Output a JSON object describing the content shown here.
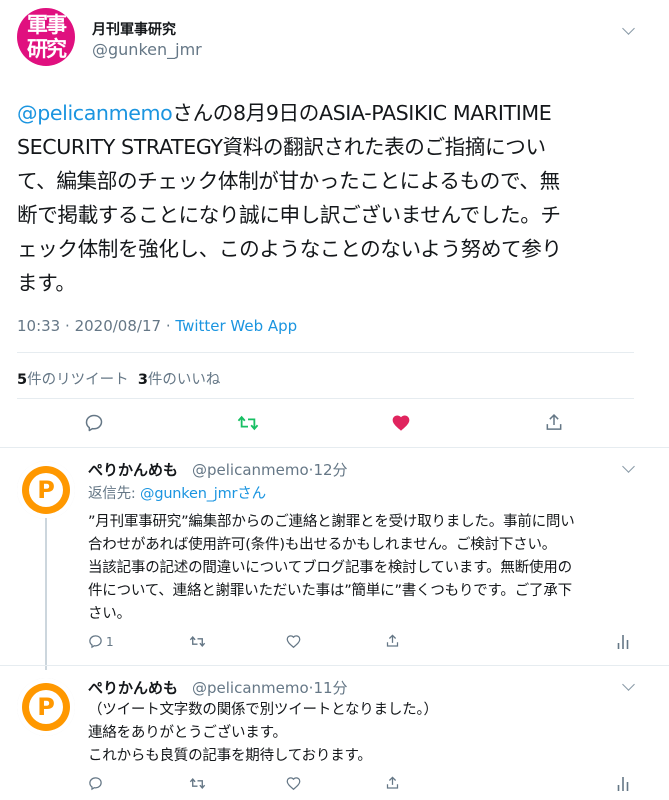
{
  "tweet": {
    "avatar_text": [
      "軍事",
      "研究"
    ],
    "author_name": "月刊軍事研究",
    "author_handle": "@gunken_jmr",
    "mention": "@pelicanmemo",
    "text_lines": [
      "さんの8月9日のASIA-PASIKIC MARITIME",
      "SECURITY STRATEGY資料の翻訳された表のご指摘につい",
      "て、編集部のチェック体制が甘かったことによるもので、無",
      "断で掲載することになり誠に申し訳ございませんでした。チ",
      "ェック体制を強化し、このようなことのないよう努めて参り",
      "ます。"
    ],
    "time": "10:33",
    "date": "2020/08/17",
    "separator": "·",
    "source": "Twitter Web App",
    "retweet_count": "5",
    "retweet_label": "件のリツイート",
    "like_count": "3",
    "like_label": "件のいいね",
    "icons": [
      "reply-icon",
      "retweet-icon",
      "like-icon-filled",
      "share-icon"
    ],
    "colors": {
      "retweet": "#17bf63",
      "like": "#e0245e",
      "link": "#1b95e0",
      "avatar": "#e0107f"
    }
  },
  "replies": [
    {
      "name": "ぺりかんめも",
      "handle": "@pelicanmemo",
      "time_ago": "12分",
      "reply_to_label": "返信先:",
      "reply_to_handle": "@gunken_jmr",
      "reply_to_suffix": "さん",
      "lines": [
        "”月刊軍事研究”編集部からのご連絡と謝罪とを受け取りました。事前に問い",
        "合わせがあれば使用許可(条件)も出せるかもしれません。ご検討下さい。",
        "当該記事の記述の間違いについてブログ記事を検討しています。無断使用の",
        "件について、連絡と謝罪いただいた事は”簡単に”書くつもりです。ご了承下",
        "さい。"
      ],
      "reply_count": "1",
      "avatar_letter": "P"
    },
    {
      "name": "ぺりかんめも",
      "handle": "@pelicanmemo",
      "time_ago": "11分",
      "lines": [
        "（ツイート文字数の関係で別ツイートとなりました。）",
        "連絡をありがとうございます。",
        "これからも良質の記事を期待しております。"
      ],
      "avatar_letter": "P"
    }
  ]
}
